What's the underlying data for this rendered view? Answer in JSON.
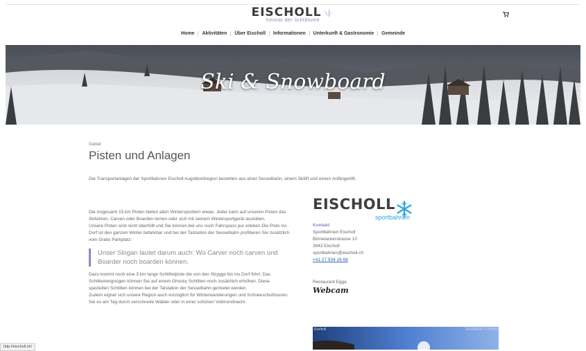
{
  "header": {
    "logo_word": "EISCHOLL",
    "logo_tagline": "heimat der lichtblume",
    "cart_icon": "cart-icon"
  },
  "nav": {
    "items": [
      "Home",
      "Aktivitäten",
      "Über Eischoll",
      "Informationen",
      "Unterkunft & Gastronomie",
      "Gemeinde"
    ]
  },
  "hero": {
    "title": "Ski & Snowboard"
  },
  "section": {
    "label": "Gebiet",
    "title": "Pisten und Anlagen",
    "intro": "Die Transportanlagen der Sportbahnen Eischoll Augstbordregion bestehen aus einer Sesselbahn, einem Skilift und einem Anfängerlift."
  },
  "left": {
    "p1": "Die insgesamt 15 km Pisten bieten allen Wintersportlern etwas. Jeder kann auf unseren Pisten das Skifahren, Carven oder Boarden lernen oder sich mit seinem Wintersportgerät austoben.",
    "p2": "Unsere Pisten sind nicht überfüllt und Sie können bei uns noch Fahrspass pur erleben.Die Piste ins Dorf ist den ganzen Winter befahrbar und bei der Talstation der Sesselbahn profitieren Sie zusätzlich vom Gratis Parkplatz.",
    "quote": "Unser Slogan lautet darum auch: Wo Carver noch carven und Boarder noch boarden können.",
    "p3": "Dazu kommt noch eine 3 km lange Schlittelpiste die von den Strygge bis ins Dorf führt. Das Schlittelvergnügen können Sie auf einem Ghosky Schlitten noch zusätzlich erhöhen. Diese speziellen Schlitten können bei der Talstation der Sesselbahn gemietet werden.",
    "p4": "Zudem eignet sich unsere Region auch vorzüglich für Winterwanderungen und Schneeschuhtouren. Sei es am Tag durch verschneite Wälder oder in einer schönen Vollmondnacht."
  },
  "right": {
    "logo_word": "EISCHOLL",
    "logo_sub": "sportbahnen",
    "kontakt_label": "Kontakt",
    "address": [
      "Sportbahnen Eischoll",
      "Binnelackerstrasse 10",
      "3943 Eischoll",
      "sportbahnen@eischoll.ch"
    ],
    "phone": "+41 27 934 16 68",
    "restaurant": "Restaurant Egga",
    "webcam": "Webcam",
    "cam_label": "Eischoll",
    "cam_time": "2016/06/16 17:53:56"
  },
  "status_bar": {
    "url": "http://eischoll.ch/"
  }
}
